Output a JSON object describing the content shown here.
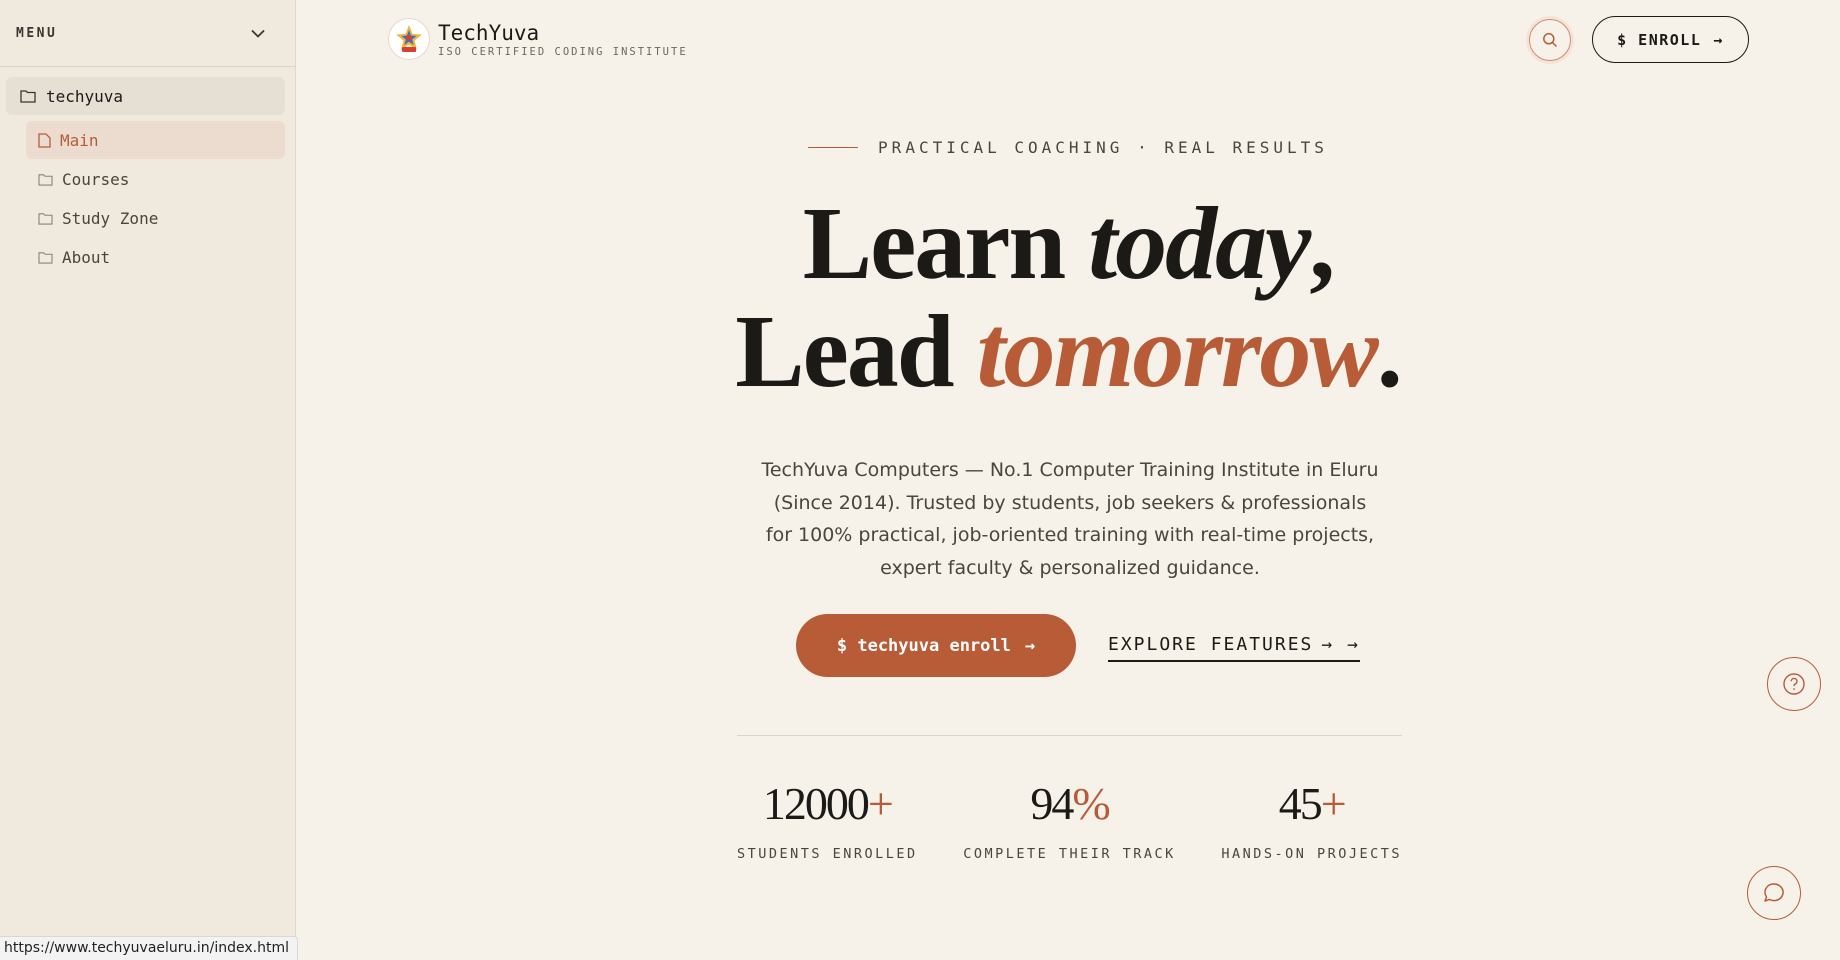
{
  "sidebar": {
    "title": "MENU",
    "root": {
      "label": "techyuva",
      "icon": "folder-icon"
    },
    "items": [
      {
        "label": "Main",
        "icon": "file-icon",
        "active": true
      },
      {
        "label": "Courses",
        "icon": "folder-icon"
      },
      {
        "label": "Study Zone",
        "icon": "folder-icon"
      },
      {
        "label": "About",
        "icon": "folder-icon"
      }
    ]
  },
  "status_bar": {
    "url": "https://www.techyuvaeluru.in/index.html"
  },
  "header": {
    "brand_name": "TechYuva",
    "brand_tagline": "ISO CERTIFIED CODING INSTITUTE",
    "enroll_label": "$ ENROLL",
    "enroll_arrow": "→"
  },
  "hero": {
    "eyebrow": "PRACTICAL COACHING · REAL RESULTS",
    "line1_plain": "Learn ",
    "line1_italic": "today",
    "line1_end": ",",
    "line2_plain": "Lead ",
    "line2_accent": "tomorrow",
    "line2_end": ".",
    "description": "TechYuva Computers — No.1 Computer Training Institute in Eluru (Since 2014). Trusted by students, job seekers & professionals for 100% practical, job-oriented training with real-time projects, expert faculty & personalized guidance.",
    "cta_label": "$ techyuva enroll",
    "cta_arrow": "→",
    "explore_label": "EXPLORE FEATURES",
    "explore_arrow": "→ →"
  },
  "stats": [
    {
      "value": "12000",
      "suffix": "+",
      "label": "STUDENTS ENROLLED"
    },
    {
      "value": "94",
      "suffix": "%",
      "label": "COMPLETE THEIR TRACK"
    },
    {
      "value": "45",
      "suffix": "+",
      "label": "HANDS-ON PROJECTS"
    }
  ],
  "colors": {
    "accent": "#b85c38",
    "background": "#f6f2ea",
    "sidebar": "#efe9de",
    "text": "#1c1a17"
  }
}
